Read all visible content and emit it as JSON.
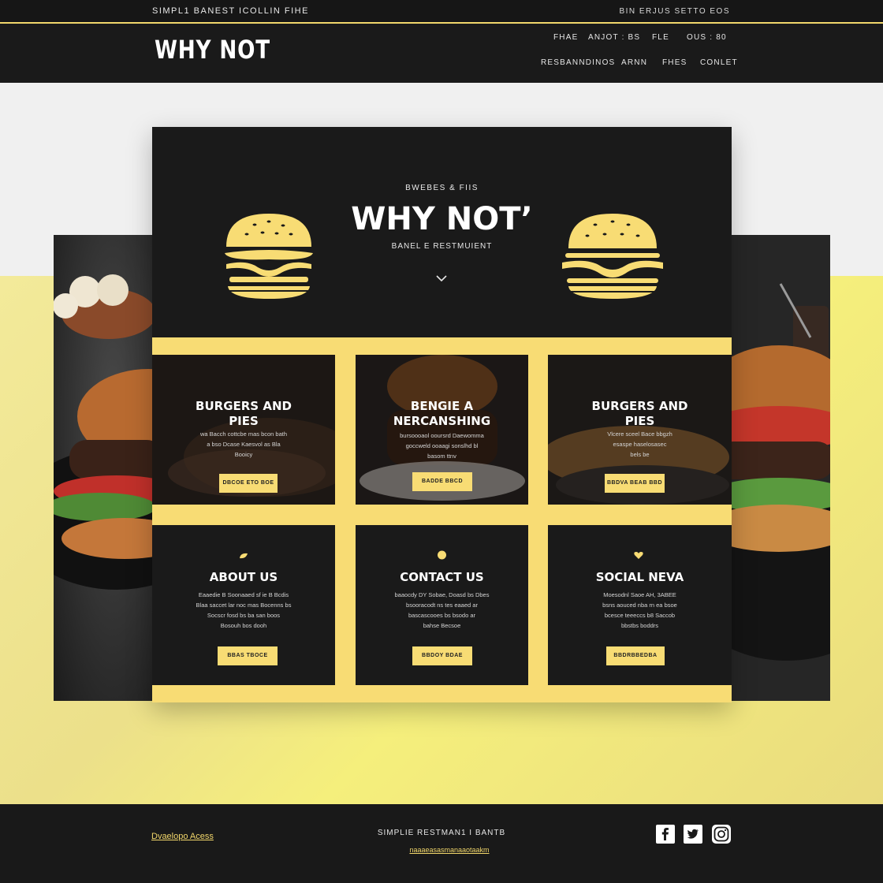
{
  "topbar": {
    "left_text": "SIMPL1 BANEST ICOLLIN FIHE",
    "right_text": "BIN ERJUS SETTO EOS"
  },
  "header": {
    "logo": "WHY NOT",
    "nav_row1": [
      "FHAE",
      "ANJOT : BS",
      "FLE",
      "OUS : 80"
    ],
    "nav_row2": [
      "RESBANNDINOS",
      "ARNN",
      "FHES",
      "CONLET"
    ]
  },
  "hero": {
    "kicker": "BWEBES & FIIS",
    "title": "WHY NOT’",
    "subtitle": "BANEL E RESTMUIENT",
    "chevron_icon": "chevron-down-icon",
    "burger_icon": "burger-icon"
  },
  "features": [
    {
      "title": "BURGERS AND\nPIES",
      "text": "wa Bacch cottcbe mas bcon bath\na bso Dcase Kaesvol as Bla\nBooicy",
      "button": "DBCOE ETO BOE"
    },
    {
      "title": "BENGIE  A\nNERCANSHING",
      "text": "bursoooaol ooursrd Daewomma\ngoccweld ooaagi sonslhd bl\nbasom ttnv",
      "button": "BADDE BBCD"
    },
    {
      "title": "BURGERS AND\nPIES",
      "text": "Vlcere sceel Bace bbgzh\nesaspe haselosasec\nbels be",
      "button": "BBDVA BEAB BBD"
    }
  ],
  "info": [
    {
      "title": "ABOUT US",
      "text": "Eaaedie B Soonaaed sf ie B Bcdis\nBlaa saccet lar noc mas Bocenns bs\nSocscr fosd bs ba san boos\nBosouh bos dooh",
      "button": "BBAS TBOCE"
    },
    {
      "title": "CONTACT US",
      "text": "baaocdy DY Sobae, Doasd bs Dbes\nbsooracodt ns tes eaaed ar\nbascascooes bs bsodo ar\nbahse Becsoe",
      "button": "BBDOY BDAE"
    },
    {
      "title": "SOCIAL NEVA",
      "text": "Moesodnl Saoe AH, 3ABEE\nbsns aouced nba rn ea bsoe\nbcesce teeeccs b8 Saccob\nbbstbs boddrs",
      "button": "BBDRBBEDBA"
    }
  ],
  "footer": {
    "left_link": "Dvaelopo Acess",
    "center_text": "SIMPLIE RESTMAN1 I BANTB",
    "email": "naaaeasasmanaaotaakm",
    "social_icons": [
      "facebook-icon",
      "twitter-icon",
      "instagram-icon"
    ]
  },
  "colors": {
    "accent": "#f8dc74",
    "dark": "#1a1a1a",
    "light": "#f2f2f2"
  }
}
